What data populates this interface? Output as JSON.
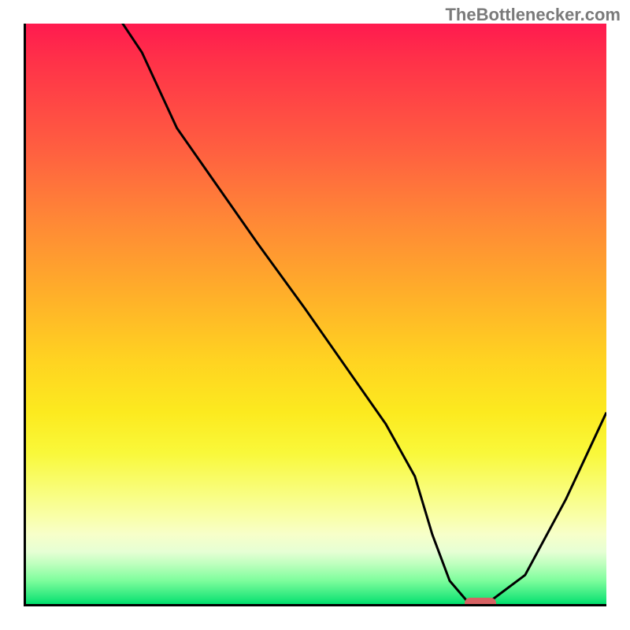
{
  "attribution": "TheBottlenecker.com",
  "chart_data": {
    "type": "line",
    "title": "",
    "xlabel": "",
    "ylabel": "",
    "xlim": [
      0,
      100
    ],
    "ylim": [
      0,
      100
    ],
    "x": [
      0,
      10,
      20,
      26,
      33,
      40,
      48,
      55,
      62,
      67,
      70,
      73,
      76,
      80,
      86,
      93,
      100
    ],
    "values": [
      125,
      110,
      95,
      82,
      72,
      62,
      51,
      41,
      31,
      22,
      12,
      4,
      0.5,
      0.5,
      5,
      18,
      33
    ],
    "marker": {
      "x": 78,
      "y": 0.5
    },
    "background_gradient": {
      "top": "#ff1a4f",
      "mid_upper": "#ff9a33",
      "mid": "#ffea22",
      "mid_lower": "#f8ff8a",
      "bottom": "#00df6c"
    },
    "line_color": "#000000",
    "marker_color": "#d76263"
  }
}
